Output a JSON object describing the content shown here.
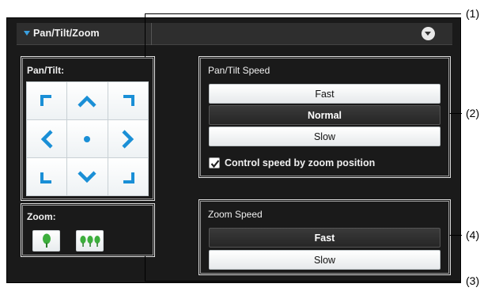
{
  "header": {
    "title": "Pan/Tilt/Zoom",
    "expand_icon": "triangle-down-icon",
    "collapse_icon": "circle-chevron-down-icon"
  },
  "pan_tilt": {
    "label": "Pan/Tilt:",
    "buttons": [
      "up-left",
      "up",
      "up-right",
      "left",
      "home",
      "right",
      "down-left",
      "down",
      "down-right"
    ]
  },
  "zoom": {
    "label": "Zoom:",
    "buttons": [
      "zoom-in-tree-icon",
      "zoom-out-trees-icon"
    ]
  },
  "pan_tilt_speed": {
    "title": "Pan/Tilt Speed",
    "options": [
      "Fast",
      "Normal",
      "Slow"
    ],
    "selected": "Normal",
    "checkbox_label": "Control speed by zoom position",
    "checkbox_checked": true
  },
  "zoom_speed": {
    "title": "Zoom Speed",
    "options": [
      "Fast",
      "Slow"
    ],
    "selected": "Fast"
  },
  "callouts": [
    "(1)",
    "(2)",
    "(3)",
    "(4)"
  ],
  "colors": {
    "panel_bg": "#1a1a1a",
    "arrow_blue": "#1a8fd6",
    "tree_green": "#3cae3c"
  }
}
